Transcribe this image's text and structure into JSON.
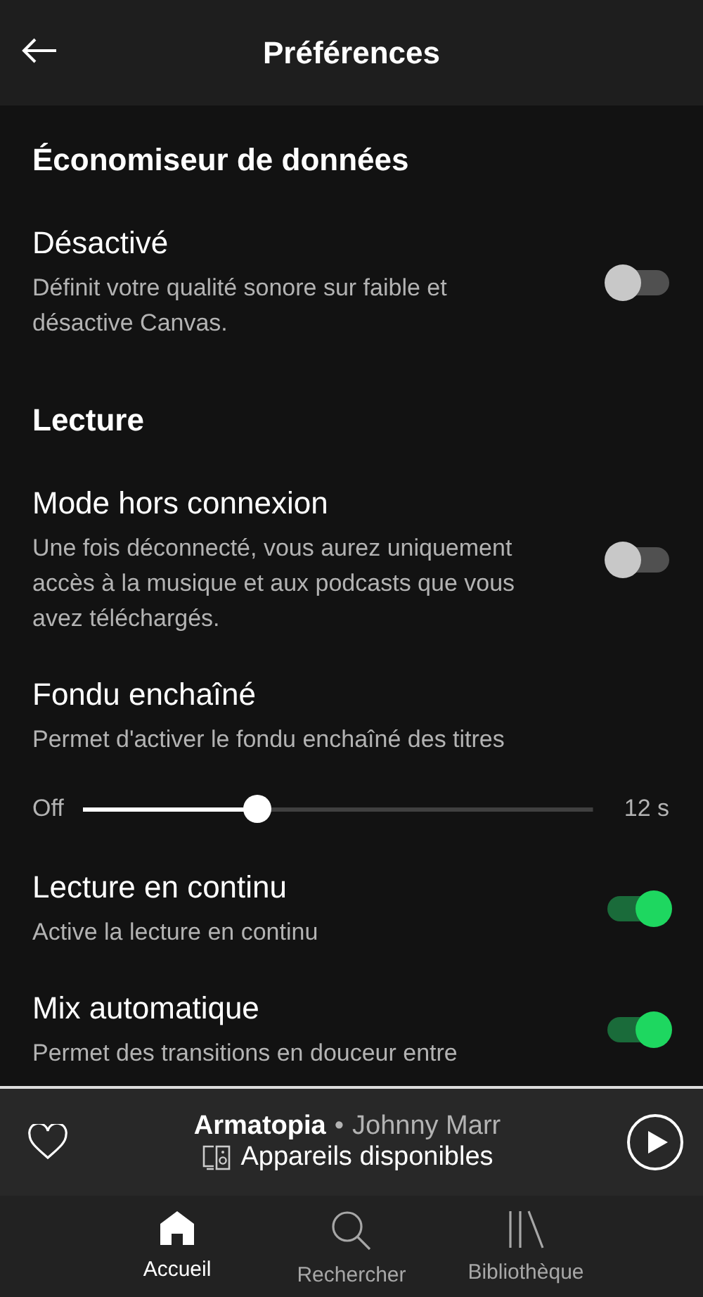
{
  "header": {
    "title": "Préférences"
  },
  "sections": [
    {
      "heading": "Économiseur de données",
      "items": [
        {
          "kind": "toggle",
          "title": "Désactivé",
          "description": "Définit votre qualité sonore sur faible et désactive Canvas.",
          "on": false
        }
      ]
    },
    {
      "heading": "Lecture",
      "items": [
        {
          "kind": "toggle",
          "title": "Mode hors connexion",
          "description": "Une fois déconnecté, vous aurez uniquement accès à la musique et aux podcasts que vous avez téléchargés.",
          "on": false
        },
        {
          "kind": "slider",
          "title": "Fondu enchaîné",
          "description": "Permet d'activer le fondu enchaîné des titres",
          "min_label": "Off",
          "max_label": "12 s",
          "level": 0.34
        },
        {
          "kind": "toggle",
          "title": "Lecture en continu",
          "description": "Active la lecture en continu",
          "on": true
        },
        {
          "kind": "toggle",
          "title": "Mix automatique",
          "description": "Permet des transitions en douceur entre",
          "on": true
        }
      ]
    }
  ],
  "player": {
    "track": "Armatopia",
    "separator": "•",
    "artist": "Johnny Marr",
    "device": "Appareils disponibles",
    "liked": false
  },
  "nav": [
    {
      "label": "Accueil",
      "selected": true
    },
    {
      "label": "Rechercher",
      "selected": false
    },
    {
      "label": "Bibliothèque",
      "selected": false
    }
  ]
}
